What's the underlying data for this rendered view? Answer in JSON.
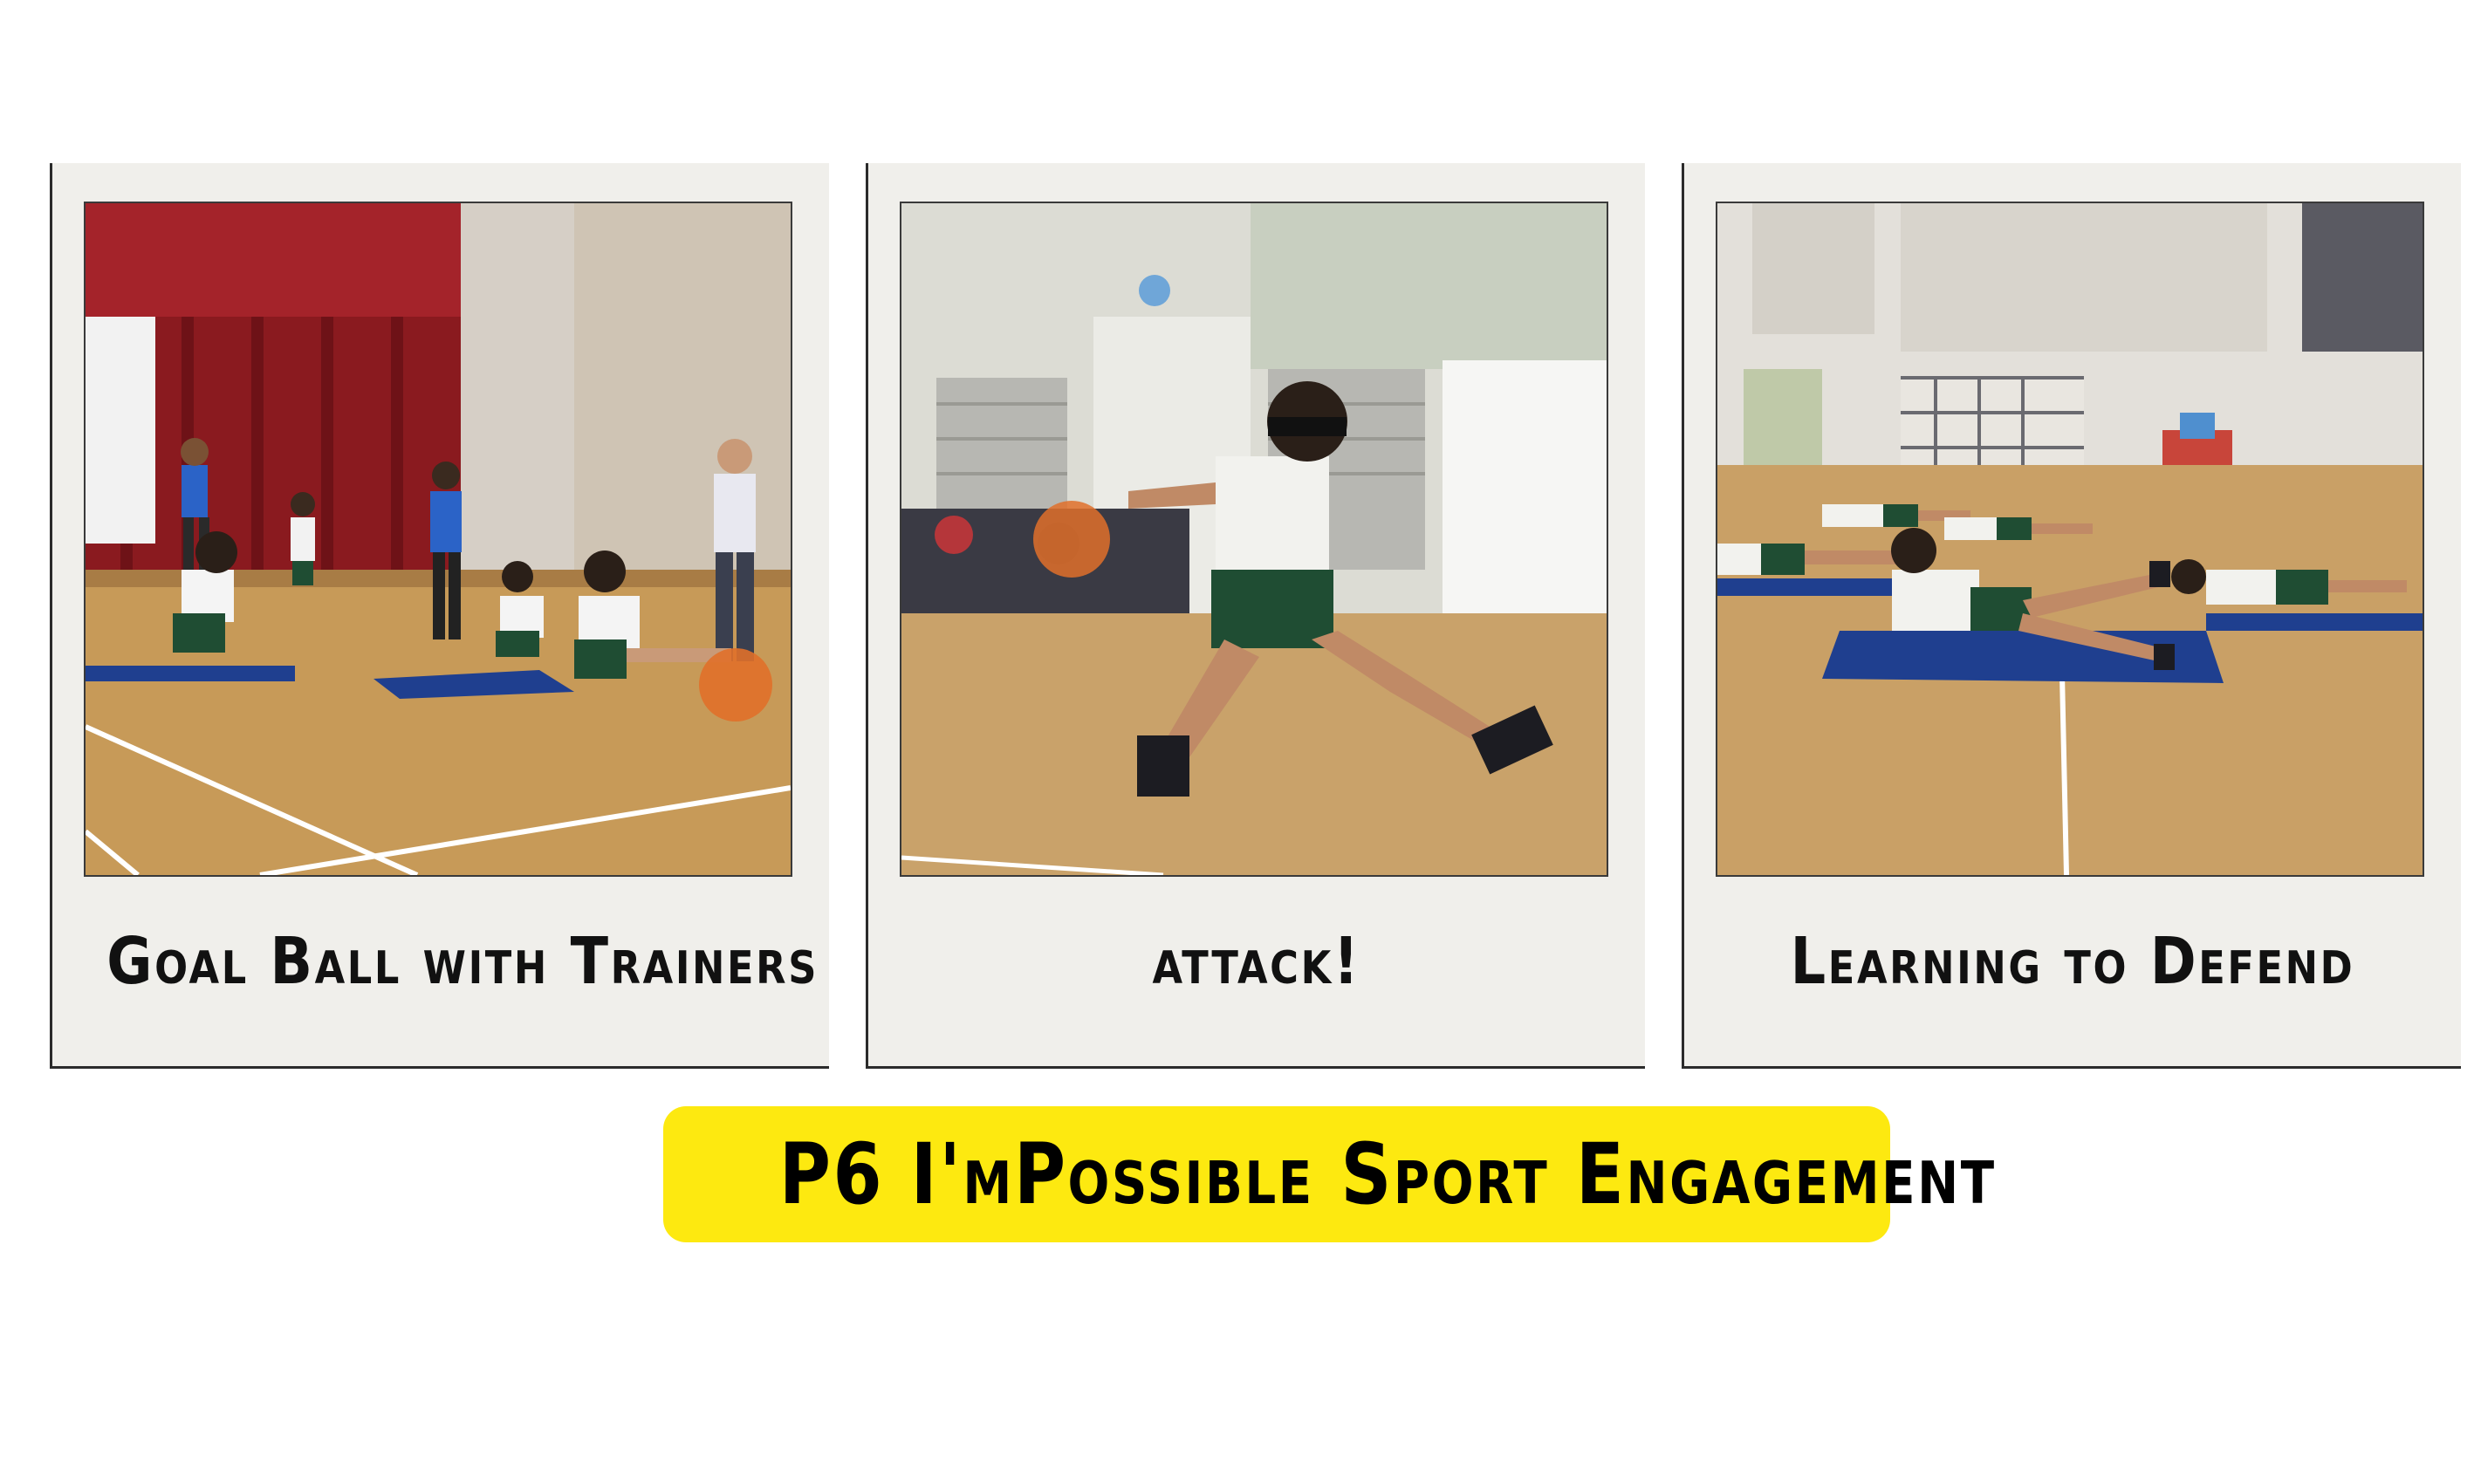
{
  "cards": [
    {
      "caption": "Goal Ball with Trainers",
      "photo_icon": "goalball-trainers-photo"
    },
    {
      "caption": "attack!",
      "photo_icon": "attack-photo"
    },
    {
      "caption": "Learning to Defend",
      "photo_icon": "defend-photo"
    }
  ],
  "banner": {
    "title": "P6 I'mPossible Sport Engagement"
  },
  "colors": {
    "banner_bg": "#fde910",
    "card_bg": "#f0efeb",
    "floor": "#c79a58",
    "mat": "#1f3f8f",
    "curtain": "#8a1a1f",
    "uniform_shorts": "#1f4d33"
  }
}
